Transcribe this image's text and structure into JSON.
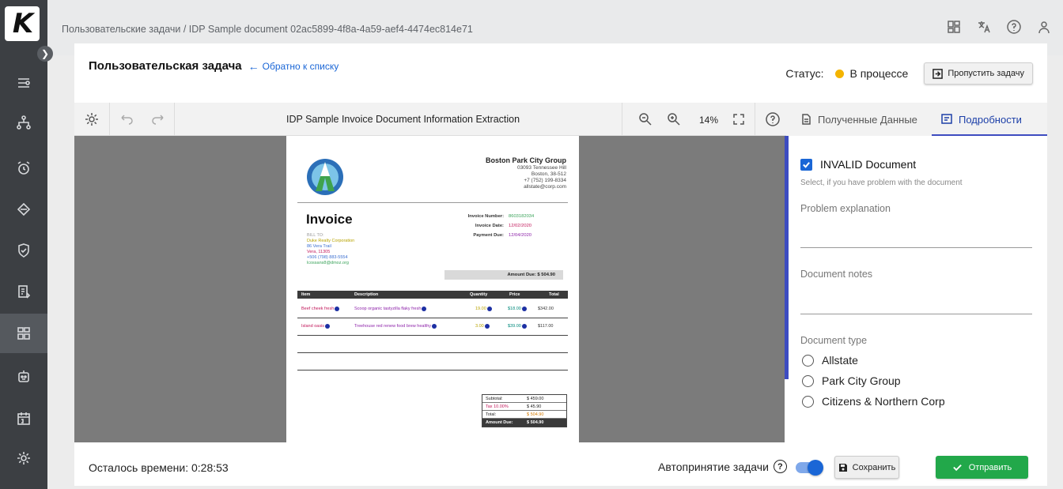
{
  "sidebar": {
    "logo": "K",
    "expand_icon": "chevron-right-icon",
    "items": [
      {
        "icon": "flow-icon"
      },
      {
        "icon": "hierarchy-icon"
      },
      {
        "icon": "alarm-icon"
      },
      {
        "icon": "database-icon"
      },
      {
        "icon": "shield-icon"
      },
      {
        "icon": "document-list-icon"
      },
      {
        "icon": "dashboard-icon",
        "active": true
      },
      {
        "icon": "robot-icon"
      },
      {
        "icon": "calendar-icon"
      },
      {
        "icon": "settings-icon"
      }
    ]
  },
  "header": {
    "breadcrumb": "Пользовательские задачи  /  IDP Sample document 02ac5899-4f8a-4a59-aef4-4474ec814e71",
    "icons": [
      "layout-icon",
      "translate-icon",
      "help-icon",
      "user-icon"
    ]
  },
  "task": {
    "title": "Пользовательская задача",
    "back_link": "Обратно к списку",
    "status_label": "Статус:",
    "status_value": "В процессе",
    "status_color": "#f4b400",
    "skip_button": "Пропустить задачу"
  },
  "viewer": {
    "document_title": "IDP Sample Invoice Document Information Extraction",
    "zoom": "14%"
  },
  "invoice": {
    "company_name": "Boston Park City Group",
    "company_address": [
      "03093 Tennessee Hill",
      "Boston, 38-512",
      "+7 (752) 199-8334",
      "allstate@corp.com"
    ],
    "heading": "Invoice",
    "bill_to_label": "BILL TO:",
    "bill_to": [
      "Duke Realty Corporation",
      "86 Vera Trail",
      "Vera, 11305",
      "+506 (798) 883-5554",
      "lcossans8@dmoz.org"
    ],
    "invoice_number_label": "Invoice Number:",
    "invoice_number": "8603182034",
    "invoice_date_label": "Invoice Date:",
    "invoice_date": "12/02/2020",
    "payment_due_label": "Payment Due:",
    "payment_due": "12/04/2020",
    "amount_due_text": "Amount Due:  $ 504.90",
    "columns": [
      "Item",
      "Description",
      "Quantity",
      "Price",
      "Total"
    ],
    "rows": [
      {
        "item": "Beef cheek fresh",
        "description": "Scoop organic tastyzilla flaky fresh",
        "quantity": "19.00",
        "price": "$18.00",
        "total": "$342.00"
      },
      {
        "item": "Island oasis",
        "description": "Treehouse red renew food brew healthy",
        "quantity": "3.00",
        "price": "$39.00",
        "total": "$117.00"
      }
    ],
    "summary": [
      {
        "label": "Subtotal:",
        "value": "$ 459.00"
      },
      {
        "label": "Tax  10.00%",
        "value": "$ 45.90"
      },
      {
        "label": "Total:",
        "value": "$ 504.90"
      },
      {
        "label": "Amount Due:",
        "value": "$ 504.90"
      }
    ]
  },
  "tabs": [
    {
      "label": "Полученные Данные",
      "icon": "document-icon"
    },
    {
      "label": "Подробности",
      "icon": "details-icon",
      "active": true
    }
  ],
  "details": {
    "invalid_label": "INVALID Document",
    "invalid_checked": true,
    "invalid_hint": "Select, if you have problem with the document",
    "problem_label": "Problem explanation",
    "problem_value": "",
    "notes_label": "Document notes",
    "notes_value": "",
    "doctype_label": "Document type",
    "doctype_options": [
      "Allstate",
      "Park City Group",
      "Citizens & Northern Corp"
    ]
  },
  "footer": {
    "timer": "Осталось времени: 0:28:53",
    "auto_accept_label": "Автопринятие задачи",
    "auto_accept_on": true,
    "save_button": "Сохранить",
    "send_button": "Отправить",
    "accent_color": "#1a66d6",
    "send_color": "#22a84a"
  }
}
